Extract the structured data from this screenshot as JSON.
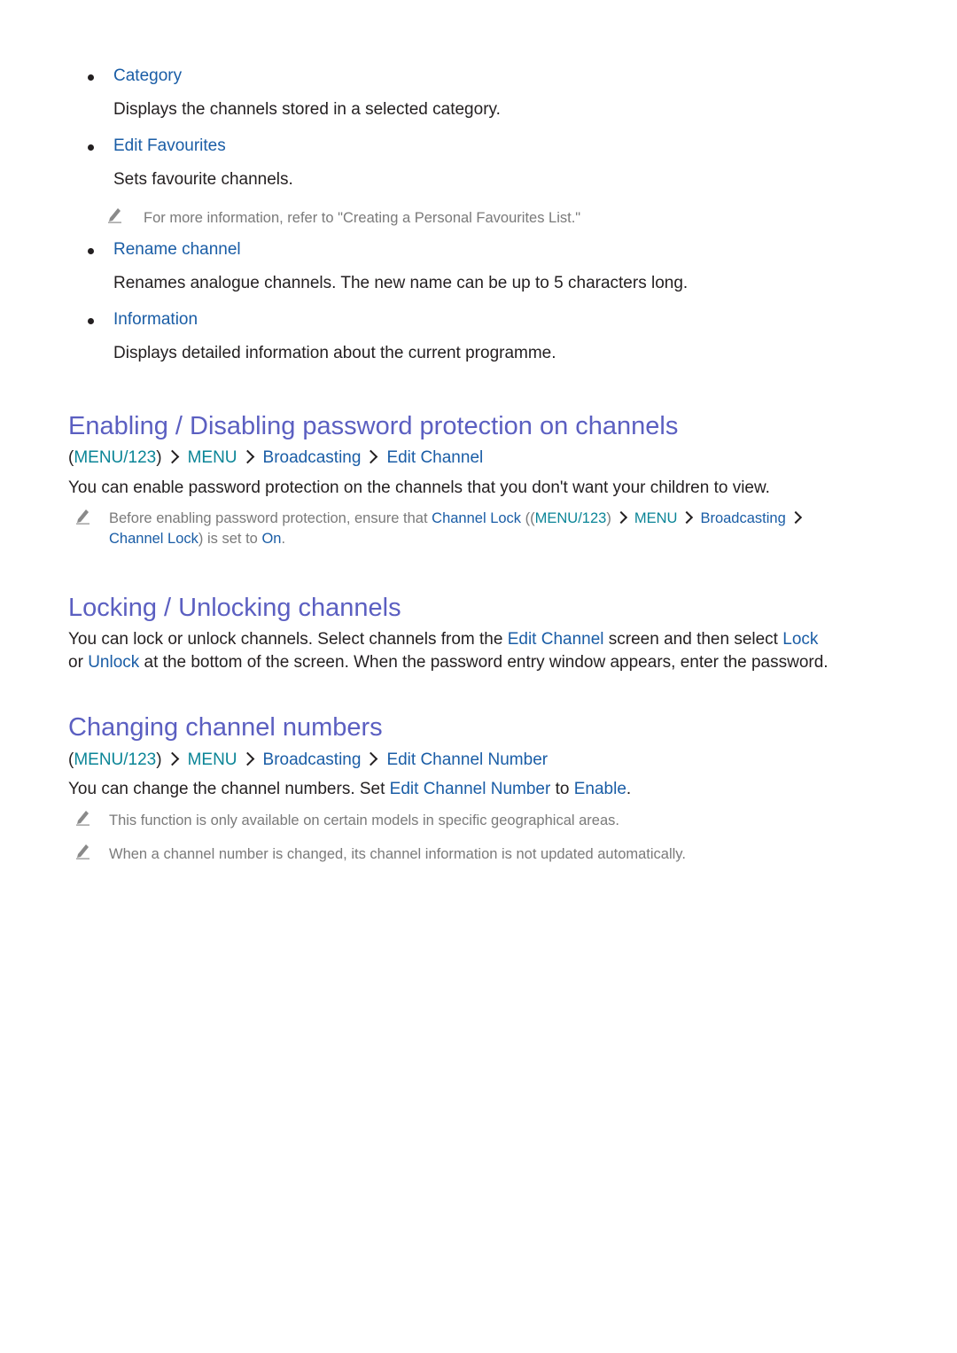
{
  "bullets": [
    {
      "title": "Category",
      "desc": [
        [
          "t",
          "Displays the channels stored in a selected category."
        ]
      ]
    },
    {
      "title": "Edit Favourites",
      "desc": [
        [
          "t",
          "Sets favourite channels."
        ]
      ],
      "note": [
        [
          "t",
          "For more information, refer to \"Creating a Personal Favourites List.\""
        ]
      ]
    },
    {
      "title": "Rename channel",
      "desc": [
        [
          "t",
          "Renames analogue channels. The new name can be up to 5 characters long."
        ]
      ]
    },
    {
      "title": "Information",
      "desc": [
        [
          "t",
          "Displays detailed information about the current programme."
        ]
      ]
    }
  ],
  "sections": [
    {
      "heading": "Enabling / Disabling password protection on channels",
      "breadcrumb": [
        [
          "t",
          "("
        ],
        [
          "m",
          "MENU/123"
        ],
        [
          "t",
          ")"
        ],
        [
          "c",
          ""
        ],
        [
          "m",
          "MENU"
        ],
        [
          "c",
          ""
        ],
        [
          "l",
          "Broadcasting"
        ],
        [
          "c",
          ""
        ],
        [
          "l",
          "Edit Channel"
        ]
      ],
      "body": [
        [
          [
            "t",
            "You can enable password protection on the channels that you don't want your children to view."
          ]
        ]
      ],
      "notes": [
        [
          [
            [
              "t",
              "Before enabling password protection, ensure that "
            ],
            [
              "l",
              "Channel Lock"
            ],
            [
              "t",
              " (("
            ],
            [
              "m",
              "MENU/123"
            ],
            [
              "t",
              ")"
            ],
            [
              "c",
              ""
            ],
            [
              "m",
              "MENU"
            ],
            [
              "c",
              ""
            ],
            [
              "l",
              "Broadcasting"
            ],
            [
              "c",
              ""
            ]
          ],
          [
            [
              "l",
              "Channel Lock"
            ],
            [
              "t",
              ") is set to "
            ],
            [
              "l",
              "On"
            ],
            [
              "t",
              "."
            ]
          ]
        ]
      ]
    },
    {
      "heading": "Locking / Unlocking channels",
      "body": [
        [
          [
            "t",
            "You can lock or unlock channels. Select channels from the "
          ],
          [
            "l",
            "Edit Channel"
          ],
          [
            "t",
            " screen and then select "
          ],
          [
            "l",
            "Lock"
          ]
        ],
        [
          [
            "t",
            "or "
          ],
          [
            "l",
            "Unlock"
          ],
          [
            "t",
            " at the bottom of the screen. When the password entry window appears, enter the password."
          ]
        ]
      ]
    },
    {
      "heading": "Changing channel numbers",
      "breadcrumb": [
        [
          "t",
          "("
        ],
        [
          "m",
          "MENU/123"
        ],
        [
          "t",
          ")"
        ],
        [
          "c",
          ""
        ],
        [
          "m",
          "MENU"
        ],
        [
          "c",
          ""
        ],
        [
          "l",
          "Broadcasting"
        ],
        [
          "c",
          ""
        ],
        [
          "l",
          "Edit Channel Number"
        ]
      ],
      "body": [
        [
          [
            "t",
            "You can change the channel numbers. Set "
          ],
          [
            "l",
            "Edit Channel Number"
          ],
          [
            "t",
            " to "
          ],
          [
            "l",
            "Enable"
          ],
          [
            "t",
            "."
          ]
        ]
      ],
      "notes": [
        [
          [
            [
              "t",
              "This function is only available on certain models in specific geographical areas."
            ]
          ]
        ],
        [
          [
            [
              "t",
              "When a channel number is changed, its channel information is not updated automatically."
            ]
          ]
        ]
      ]
    }
  ],
  "icons": {
    "note": "pencil-icon",
    "separator": "chevron-right-icon",
    "bullet": "bullet-icon"
  },
  "colors": {
    "heading": "#5b5fc1",
    "link": "#1a5da6",
    "menu": "#0b8597",
    "text": "#231f20",
    "note": "#7a7a7a"
  }
}
